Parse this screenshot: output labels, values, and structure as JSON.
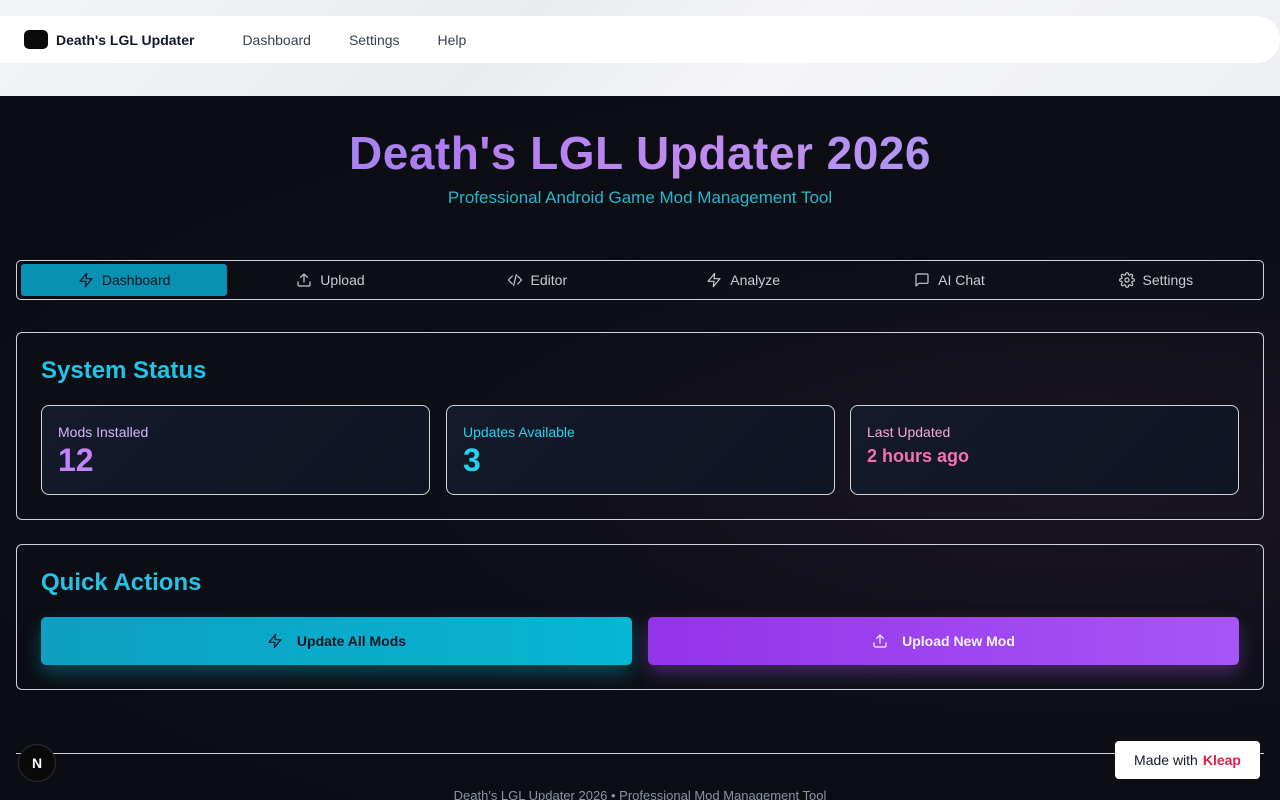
{
  "navbar": {
    "brand": "Death's LGL Updater",
    "links": [
      "Dashboard",
      "Settings",
      "Help"
    ]
  },
  "hero": {
    "title": "Death's LGL Updater 2026",
    "subtitle": "Professional Android Game Mod Management Tool"
  },
  "tabs": [
    {
      "label": "Dashboard",
      "icon": "zap-icon",
      "active": true
    },
    {
      "label": "Upload",
      "icon": "upload-icon",
      "active": false
    },
    {
      "label": "Editor",
      "icon": "code-icon",
      "active": false
    },
    {
      "label": "Analyze",
      "icon": "zap-icon",
      "active": false
    },
    {
      "label": "AI Chat",
      "icon": "message-square-icon",
      "active": false
    },
    {
      "label": "Settings",
      "icon": "gear-icon",
      "active": false
    }
  ],
  "status": {
    "title": "System Status",
    "cards": [
      {
        "label": "Mods Installed",
        "value": "12"
      },
      {
        "label": "Updates Available",
        "value": "3"
      },
      {
        "label": "Last Updated",
        "value": "2 hours ago"
      }
    ]
  },
  "actions": {
    "title": "Quick Actions",
    "update_label": "Update All Mods",
    "upload_label": "Upload New Mod"
  },
  "footer": {
    "text": "Death's LGL Updater 2026 • Professional Mod Management Tool"
  },
  "badge": {
    "n_letter": "N",
    "made_with": "Made with",
    "brand": "Kleap"
  },
  "colors": {
    "accent_cyan": "#22c3e6",
    "accent_purple": "#a855f7",
    "accent_pink": "#f472b6"
  }
}
